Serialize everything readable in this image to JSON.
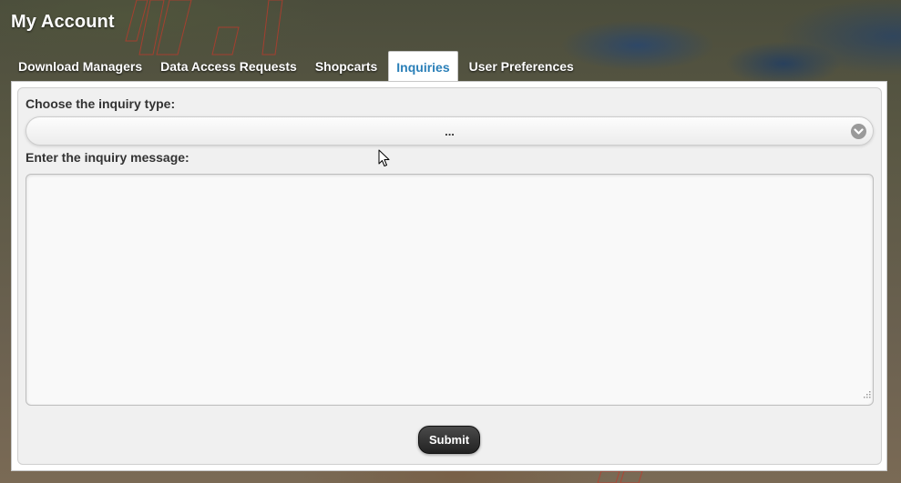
{
  "header": {
    "title": "My Account"
  },
  "tabs": [
    {
      "label": "Download Managers",
      "active": false
    },
    {
      "label": "Data Access Requests",
      "active": false
    },
    {
      "label": "Shopcarts",
      "active": false
    },
    {
      "label": "Inquiries",
      "active": true
    },
    {
      "label": "User Preferences",
      "active": false
    }
  ],
  "form": {
    "type_label": "Choose the inquiry type:",
    "type_selected": "...",
    "message_label": "Enter the inquiry message:",
    "message_value": "",
    "submit_label": "Submit"
  },
  "icons": {
    "select_icon": "chevron-down-icon",
    "resize_icon": "resize-grip-icon",
    "cursor_icon": "mouse-pointer-icon"
  },
  "colors": {
    "active_tab_text": "#2a7fb8",
    "submit_bg": "#333333"
  }
}
